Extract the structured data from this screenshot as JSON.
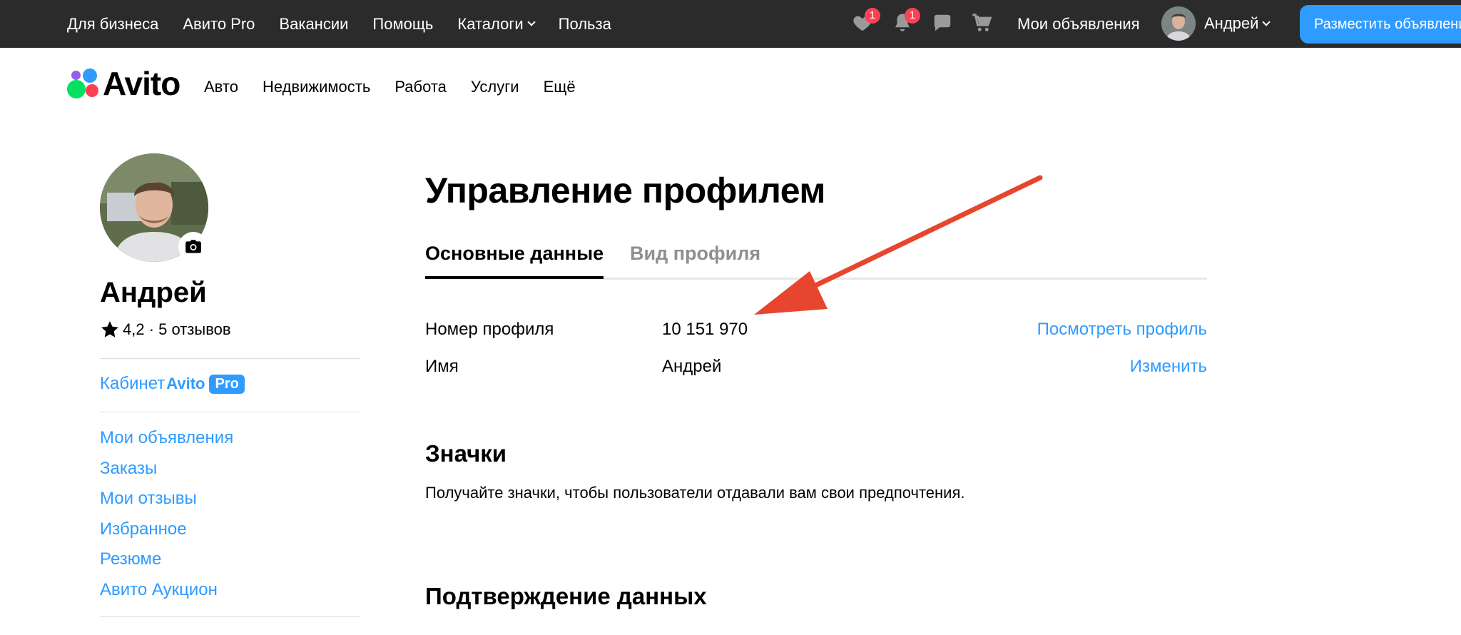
{
  "topbar": {
    "nav": [
      "Для бизнеса",
      "Авито Pro",
      "Вакансии",
      "Помощь",
      "Каталоги",
      "Польза"
    ],
    "favorites_badge": "1",
    "notifications_badge": "1",
    "my_ads": "Мои объявления",
    "user_name": "Андрей",
    "post_button": "Разместить объявление"
  },
  "header": {
    "logo": "Avito",
    "categories": [
      "Авто",
      "Недвижимость",
      "Работа",
      "Услуги",
      "Ещё"
    ]
  },
  "sidebar": {
    "name": "Андрей",
    "rating": "4,2 · 5 отзывов",
    "pro_label": "Кабинет",
    "pro_brand": "Avito",
    "pro_tag": "Pro",
    "items": [
      "Мои объявления",
      "Заказы",
      "Мои отзывы",
      "Избранное",
      "Резюме",
      "Авито Аукцион"
    ]
  },
  "main": {
    "title": "Управление профилем",
    "tabs": [
      "Основные данные",
      "Вид профиля"
    ],
    "rows": [
      {
        "label": "Номер профиля",
        "value": "10 151 970",
        "action": "Посмотреть профиль"
      },
      {
        "label": "Имя",
        "value": "Андрей",
        "action": "Изменить"
      }
    ],
    "badges_title": "Значки",
    "badges_text": "Получайте значки, чтобы пользователи отдавали вам свои предпочтения.",
    "verify_title": "Подтверждение данных"
  },
  "colors": {
    "topbar_bg": "#2b2b2b",
    "accent_blue": "#2f9bff",
    "badge_red": "#ff4053",
    "annotation_arrow": "#e8452f"
  }
}
